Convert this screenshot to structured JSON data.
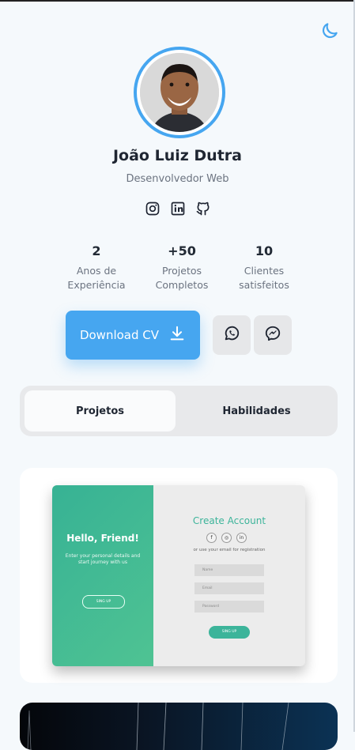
{
  "header": {
    "theme_toggle_icon": "moon-icon"
  },
  "profile": {
    "name": "João Luiz Dutra",
    "role": "Desenvolvedor Web",
    "ring_color": "#46a6f0"
  },
  "socials": [
    {
      "icon": "instagram-icon"
    },
    {
      "icon": "linkedin-icon"
    },
    {
      "icon": "github-icon"
    }
  ],
  "stats": [
    {
      "value": "2",
      "label_line1": "Anos de",
      "label_line2": "Experiência"
    },
    {
      "value": "+50",
      "label_line1": "Projetos",
      "label_line2": "Completos"
    },
    {
      "value": "10",
      "label_line1": "Clientes",
      "label_line2": "satisfeitos"
    }
  ],
  "actions": {
    "download_label": "Download CV",
    "download_icon": "download-icon",
    "whatsapp_icon": "whatsapp-icon",
    "messenger_icon": "messenger-icon",
    "accent_color": "#46a6f0"
  },
  "tabs": [
    {
      "label": "Projetos",
      "active": true
    },
    {
      "label": "Habilidades",
      "active": false
    }
  ],
  "project_preview": {
    "left_title": "Hello, Friend!",
    "left_text": "Enter your personal details and start journey with us",
    "left_button": "SING UP",
    "right_title": "Create Account",
    "social_letters": [
      "f",
      "◎",
      "in"
    ],
    "right_subtitle": "or use your email for registration",
    "fields": [
      "Name",
      "Email",
      "Password"
    ],
    "right_button": "SING UP",
    "brand_color": "#3cb49a"
  }
}
